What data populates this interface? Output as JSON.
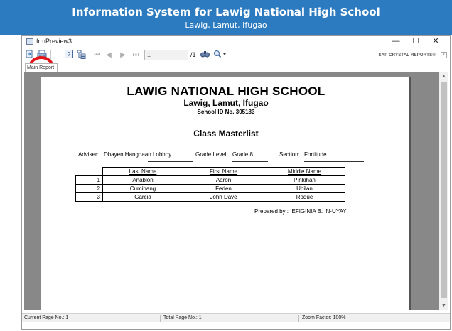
{
  "banner": {
    "title": "Information System for Lawig National High School",
    "subtitle": "Lawig, Lamut, Ifugao",
    "color": "#2c7bc0"
  },
  "window": {
    "title": "frmPreview3",
    "minimize": "—",
    "maximize": "☐",
    "close": "✕"
  },
  "toolbar": {
    "export_icon": "export-icon",
    "print_icon": "print-icon",
    "help_icon": "help-icon",
    "tree_icon": "group-tree-icon",
    "first": "⏮",
    "prev": "◀",
    "next": "▶",
    "last": "⏭",
    "page_value": "1",
    "page_total": "/1",
    "find_icon": "find-icon",
    "zoom_icon": "zoom-icon",
    "brand": "SAP CRYSTAL REPORTS®",
    "highlight_color": "#e0161b"
  },
  "tab": {
    "label": "Main Report"
  },
  "report": {
    "school": "LAWIG NATIONAL HIGH SCHOOL",
    "location": "Lawig, Lamut, Ifugao",
    "school_id": "School ID No. 305183",
    "type": "Class Masterlist",
    "adviser_label": "Adviser:",
    "adviser": "Dhayen Hangdaan Lobhoy",
    "grade_label": "Grade Level:",
    "grade": "Grade 8",
    "section_label": "Section:",
    "section": "Fortitude",
    "columns": [
      "Last Name",
      "First Name",
      "Middle Name"
    ],
    "rows": [
      {
        "no": "1",
        "last": "Anablon",
        "first": "Aaron",
        "middle": "Pinkihan"
      },
      {
        "no": "2",
        "last": "Cumihang",
        "first": "Feden",
        "middle": "Uhilan"
      },
      {
        "no": "3",
        "last": "Garcia",
        "first": "John Dave",
        "middle": "Roque"
      }
    ],
    "prepared_label": "Prepared by :",
    "prepared_by": "EFIGINIA B. IN-UYAY"
  },
  "scroll": {
    "up": "▲",
    "down": "▼"
  },
  "status": {
    "current_page": "Current Page No.: 1",
    "total_page": "Total Page No.: 1",
    "zoom": "Zoom Factor: 100%"
  }
}
